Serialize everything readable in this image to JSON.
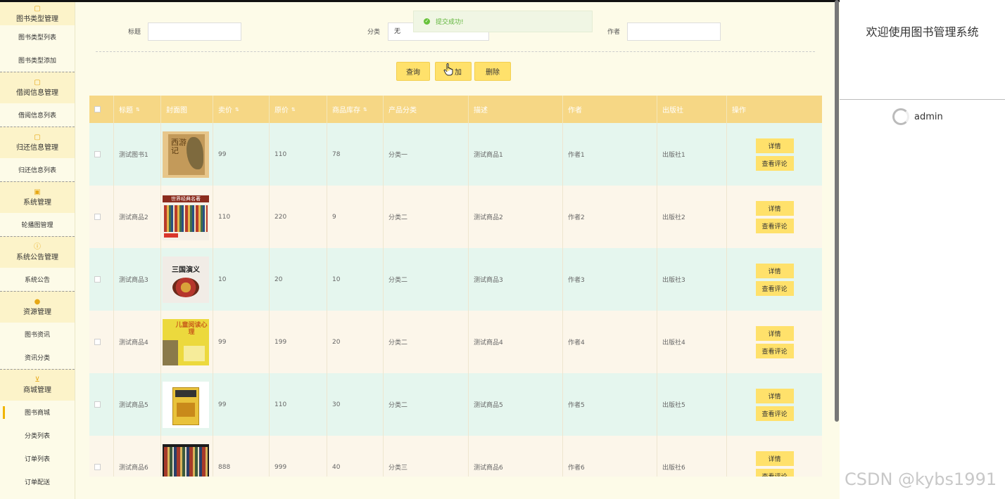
{
  "sidebar": {
    "groups": [
      {
        "title": "图书类型管理",
        "icon": "folder-icon",
        "items": [
          "图书类型列表",
          "图书类型添加"
        ]
      },
      {
        "title": "借阅信息管理",
        "icon": "folder-icon",
        "items": [
          "借阅信息列表"
        ]
      },
      {
        "title": "归还信息管理",
        "icon": "folder-icon",
        "items": [
          "归还信息列表"
        ]
      },
      {
        "title": "系统管理",
        "icon": "image-icon",
        "items": [
          "轮播图管理"
        ]
      },
      {
        "title": "系统公告管理",
        "icon": "info-icon",
        "items": [
          "系统公告"
        ]
      },
      {
        "title": "资源管理",
        "icon": "pin-icon",
        "items": [
          "图书资讯",
          "资讯分类"
        ]
      },
      {
        "title": "商城管理",
        "icon": "cart-icon",
        "items": [
          "图书商城",
          "分类列表",
          "订单列表",
          "订单配送"
        ]
      }
    ],
    "active_item": "图书商城"
  },
  "toast": {
    "text": "提交成功!"
  },
  "filter": {
    "title_label": "标题",
    "title_value": "",
    "category_label": "分类",
    "category_value": "无",
    "author_label": "作者",
    "author_value": ""
  },
  "actions": {
    "query": "查询",
    "add": "添加",
    "delete": "删除",
    "add_visible": "加"
  },
  "table": {
    "headers": [
      "标题",
      "封面图",
      "卖价",
      "原价",
      "商品库存",
      "产品分类",
      "描述",
      "作者",
      "出版社",
      "操作"
    ],
    "rows": [
      {
        "title": "测试图书1",
        "cover": "西游记",
        "price": "99",
        "orig": "110",
        "stock": "78",
        "cat": "分类一",
        "desc": "测试商品1",
        "author": "作者1",
        "pub": "出版社1"
      },
      {
        "title": "测试商品2",
        "cover": "世界经典名著",
        "price": "110",
        "orig": "220",
        "stock": "9",
        "cat": "分类二",
        "desc": "测试商品2",
        "author": "作者2",
        "pub": "出版社2"
      },
      {
        "title": "测试商品3",
        "cover": "三国演义",
        "price": "10",
        "orig": "20",
        "stock": "10",
        "cat": "分类二",
        "desc": "测试商品3",
        "author": "作者3",
        "pub": "出版社3"
      },
      {
        "title": "测试商品4",
        "cover": "儿童阅读心理",
        "price": "99",
        "orig": "199",
        "stock": "20",
        "cat": "分类二",
        "desc": "测试商品4",
        "author": "作者4",
        "pub": "出版社4"
      },
      {
        "title": "测试商品5",
        "cover": "",
        "price": "99",
        "orig": "110",
        "stock": "30",
        "cat": "分类二",
        "desc": "测试商品5",
        "author": "作者5",
        "pub": "出版社5"
      },
      {
        "title": "测试商品6",
        "cover": "",
        "price": "888",
        "orig": "999",
        "stock": "40",
        "cat": "分类三",
        "desc": "测试商品6",
        "author": "作者6",
        "pub": "出版社6"
      }
    ],
    "op_detail": "详情",
    "op_comment": "查看评论"
  },
  "right_panel": {
    "welcome": "欢迎使用图书管理系统",
    "user": "admin"
  },
  "watermark": "CSDN @kybs1991"
}
